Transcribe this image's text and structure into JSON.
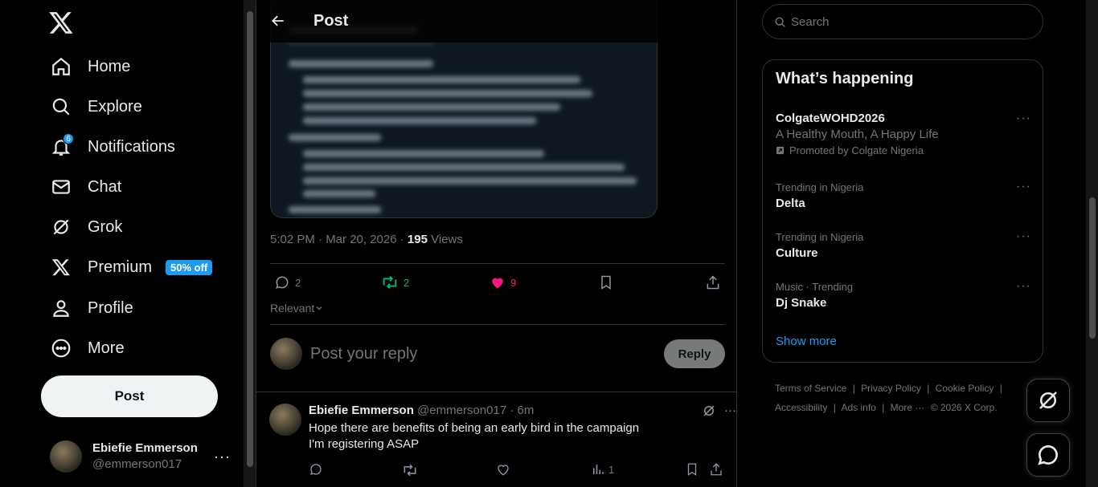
{
  "sidebar": {
    "logo": "x-logo-icon",
    "items": [
      {
        "label": "Home",
        "icon": "home-icon"
      },
      {
        "label": "Explore",
        "icon": "search-icon"
      },
      {
        "label": "Notifications",
        "icon": "bell-icon",
        "badge": "6"
      },
      {
        "label": "Chat",
        "icon": "mail-icon"
      },
      {
        "label": "Grok",
        "icon": "grok-icon"
      },
      {
        "label": "Premium",
        "icon": "x-logo-icon",
        "promo": "50% off"
      },
      {
        "label": "Profile",
        "icon": "person-icon"
      },
      {
        "label": "More",
        "icon": "more-circle-icon"
      }
    ],
    "post_button": "Post",
    "account": {
      "display_name": "Ebiefie Emmerson",
      "handle": "@emmerson017"
    }
  },
  "main": {
    "header_title": "Post",
    "meta": {
      "time": "5:02 PM · Mar 20, 2026 · ",
      "views": "195",
      "views_label": " Views"
    },
    "actions": {
      "replies": "2",
      "reposts": "2",
      "likes": "9"
    },
    "sort_label": "Relevant",
    "composer": {
      "placeholder": "Post your reply",
      "button": "Reply"
    },
    "reply": {
      "display_name": "Ebiefie Emmerson",
      "handle_time": "@emmerson017 · 6m",
      "text_line1": "Hope there are benefits of being an early bird in the campaign",
      "text_line2": "I'm registering ASAP",
      "views": "1"
    }
  },
  "right": {
    "search_placeholder": "Search",
    "trends_title": "What’s happening",
    "trends": [
      {
        "name": "ColgateWOHD2026",
        "subtitle": "A Healthy Mouth, A Happy Life",
        "promoted": "Promoted by Colgate Nigeria"
      },
      {
        "category": "Trending in Nigeria",
        "name": "Delta"
      },
      {
        "category": "Trending in Nigeria",
        "name": "Culture"
      },
      {
        "category": "Music · Trending",
        "name": "Dj Snake"
      }
    ],
    "show_more": "Show more",
    "footer": [
      "Terms of Service",
      "|",
      "Privacy Policy",
      "|",
      "Cookie Policy",
      "|",
      "Accessibility",
      "|",
      "Ads info",
      "|",
      "More ···",
      "© 2026 X Corp."
    ]
  },
  "colors": {
    "accent": "#1d9bf0",
    "like": "#f91880",
    "repost": "#00ba7c",
    "border": "#2f3336",
    "muted": "#71767b"
  }
}
